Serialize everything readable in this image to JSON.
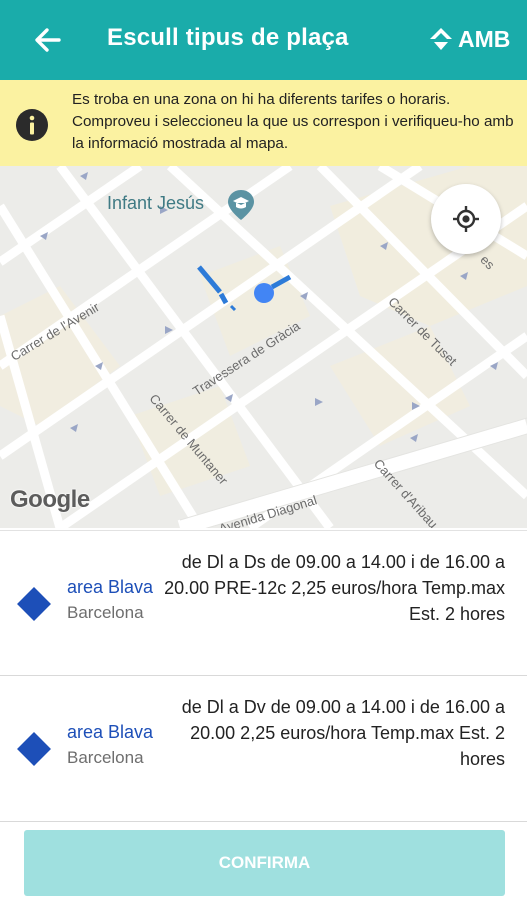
{
  "header": {
    "title": "Escull tipus de plaça",
    "brand": "AMB",
    "back_icon": "arrow-left-icon",
    "background": "#1aacaa"
  },
  "banner": {
    "icon": "info-icon",
    "text": "Es troba en una zona on hi ha diferents tarifes o horaris. Comproveu i seleccioneu la que us correspon i verifiqueu-ho amb la informació mostrada al mapa.",
    "background": "#fbf2a1"
  },
  "map": {
    "poi": "Infant Jesús",
    "streets": [
      "Carrer de l'Avenir",
      "Travessera de Gràcia",
      "Carrer de Tuset",
      "Carrer de Muntaner",
      "Avenida Diagonal",
      "Carrer d'Aribau"
    ],
    "edge_label": "es",
    "attribution": "Google",
    "locate_icon": "my-location-icon"
  },
  "options": [
    {
      "name": "area Blava",
      "city": "Barcelona",
      "schedule": "de Dl a Ds de 09.00 a 14.00 i de 16.00 a 20.00 PRE-12c 2,25 euros/hora Temp.max Est. 2 hores",
      "color": "#1d4fb8"
    },
    {
      "name": "area Blava",
      "city": "Barcelona",
      "schedule": "de Dl a Dv de 09.00 a 14.00 i de 16.00 a 20.00 2,25 euros/hora Temp.max Est. 2 hores",
      "color": "#1d4fb8"
    }
  ],
  "confirm": {
    "label": "CONFIRMA",
    "color": "#9fe0df"
  }
}
